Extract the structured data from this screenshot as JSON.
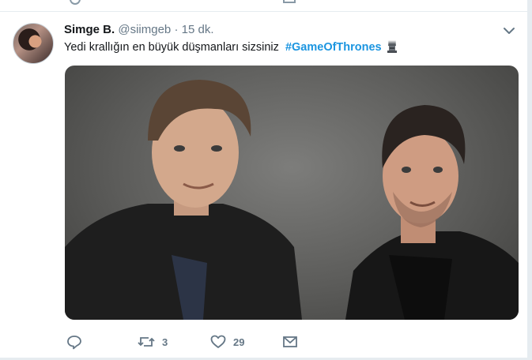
{
  "tweet": {
    "display_name": "Simge B.",
    "handle": "@siimgeb",
    "separator": "·",
    "time": "15 dk.",
    "text": "Yedi krallığın en büyük düşmanları sizsiniz",
    "hashtag": "#GameOfThrones",
    "emoji": "throne-emoji",
    "actions": {
      "reply_count": "",
      "retweet_count": "3",
      "like_count": "29"
    }
  },
  "colors": {
    "link": "#1b95e0",
    "muted": "#657786",
    "background": "#e6ecf0"
  }
}
